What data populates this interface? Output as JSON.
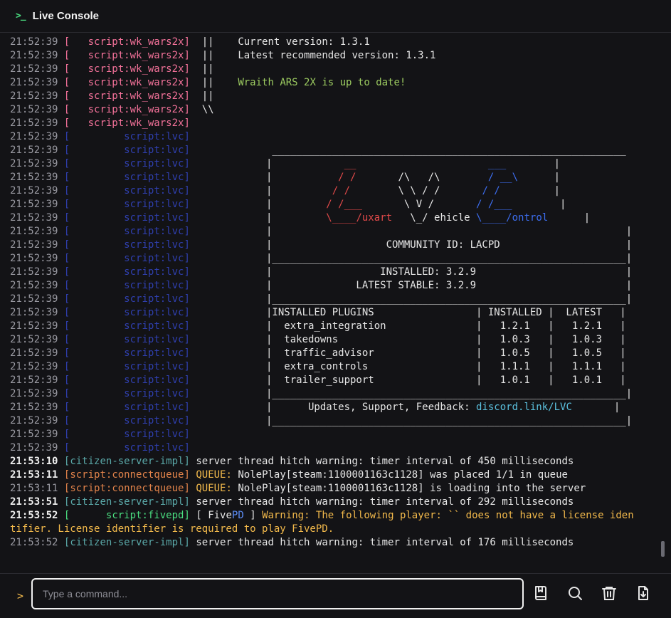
{
  "header": {
    "title": "Live Console",
    "icon": "terminal-icon",
    "icon_glyph": ">_"
  },
  "colors": {
    "wk": "#f4729a",
    "lvc": "#2f3fae",
    "citizen": "#5aa8a8",
    "cq": "#e0824a",
    "fivepd": "#4ade80",
    "yellow": "#f2b94b",
    "green_msg": "#9ccb60",
    "art_red": "#e24a4a",
    "art_blue": "#3d6ef0",
    "link": "#5bc0de",
    "fivepd_pd": "#5b8bf2"
  },
  "log": [
    {
      "ts": "21:52:39",
      "tag": "script:wk_wars2x",
      "type": "wk",
      "msg": "  ||    Current version: 1.3.1"
    },
    {
      "ts": "21:52:39",
      "tag": "script:wk_wars2x",
      "type": "wk",
      "msg": "  ||    Latest recommended version: 1.3.1"
    },
    {
      "ts": "21:52:39",
      "tag": "script:wk_wars2x",
      "type": "wk",
      "msg": "  ||"
    },
    {
      "ts": "21:52:39",
      "tag": "script:wk_wars2x",
      "type": "wk",
      "msg": "  ||    ",
      "green": "Wraith ARS 2X is up to date!"
    },
    {
      "ts": "21:52:39",
      "tag": "script:wk_wars2x",
      "type": "wk",
      "msg": "  ||"
    },
    {
      "ts": "21:52:39",
      "tag": "script:wk_wars2x",
      "type": "wk",
      "msg": "  \\\\"
    },
    {
      "ts": "21:52:39",
      "tag": "script:wk_wars2x",
      "type": "wk",
      "msg": ""
    },
    {
      "ts": "21:52:39",
      "tag": "script:lvc",
      "type": "lvc",
      "art": ""
    },
    {
      "ts": "21:52:39",
      "tag": "script:lvc",
      "type": "lvc",
      "art": " ___________________________________________________________"
    },
    {
      "ts": "21:52:39",
      "tag": "script:lvc",
      "type": "lvc",
      "art": "|",
      "r": "            __",
      "w": "                      ",
      "b": "___",
      "e": "        |"
    },
    {
      "ts": "21:52:39",
      "tag": "script:lvc",
      "type": "lvc",
      "art": "|",
      "r": "           / /",
      "w": "       /\\   /\\        ",
      "b": "/ __\\",
      "e": "      |"
    },
    {
      "ts": "21:52:39",
      "tag": "script:lvc",
      "type": "lvc",
      "art": "|",
      "r": "          / /",
      "w": "        \\ \\ / /       ",
      "b": "/ /",
      "e": "         |"
    },
    {
      "ts": "21:52:39",
      "tag": "script:lvc",
      "type": "lvc",
      "art": "|",
      "r": "         / /___",
      "w": "       \\ V /       ",
      "b": "/ /___",
      "e": "        |"
    },
    {
      "ts": "21:52:39",
      "tag": "script:lvc",
      "type": "lvc",
      "art": "|",
      "r": "         \\____/uxart",
      "w": "   \\_/ ehicle ",
      "b": "\\____/ontrol",
      "e": "      |"
    },
    {
      "ts": "21:52:39",
      "tag": "script:lvc",
      "type": "lvc",
      "art": "|                                                           |"
    },
    {
      "ts": "21:52:39",
      "tag": "script:lvc",
      "type": "lvc",
      "art": "|                   COMMUNITY ID: LACPD                     |"
    },
    {
      "ts": "21:52:39",
      "tag": "script:lvc",
      "type": "lvc",
      "art": "|___________________________________________________________|"
    },
    {
      "ts": "21:52:39",
      "tag": "script:lvc",
      "type": "lvc",
      "art": "|                  INSTALLED: 3.2.9                         |"
    },
    {
      "ts": "21:52:39",
      "tag": "script:lvc",
      "type": "lvc",
      "art": "|              LATEST STABLE: 3.2.9                         |"
    },
    {
      "ts": "21:52:39",
      "tag": "script:lvc",
      "type": "lvc",
      "art": "|___________________________________________________________|"
    },
    {
      "ts": "21:52:39",
      "tag": "script:lvc",
      "type": "lvc",
      "art": "|INSTALLED PLUGINS                 | INSTALLED |  LATEST   |"
    },
    {
      "ts": "21:52:39",
      "tag": "script:lvc",
      "type": "lvc",
      "art": "|  extra_integration               |   1.2.1   |   1.2.1   |"
    },
    {
      "ts": "21:52:39",
      "tag": "script:lvc",
      "type": "lvc",
      "art": "|  takedowns                       |   1.0.3   |   1.0.3   |"
    },
    {
      "ts": "21:52:39",
      "tag": "script:lvc",
      "type": "lvc",
      "art": "|  traffic_advisor                 |   1.0.5   |   1.0.5   |"
    },
    {
      "ts": "21:52:39",
      "tag": "script:lvc",
      "type": "lvc",
      "art": "|  extra_controls                  |   1.1.1   |   1.1.1   |"
    },
    {
      "ts": "21:52:39",
      "tag": "script:lvc",
      "type": "lvc",
      "art": "|  trailer_support                 |   1.0.1   |   1.0.1   |"
    },
    {
      "ts": "21:52:39",
      "tag": "script:lvc",
      "type": "lvc",
      "art": "|___________________________________________________________|"
    },
    {
      "ts": "21:52:39",
      "tag": "script:lvc",
      "type": "lvc",
      "art": "|      Updates, Support, Feedback: ",
      "link": "discord.link/LVC",
      "e": "       |"
    },
    {
      "ts": "21:52:39",
      "tag": "script:lvc",
      "type": "lvc",
      "art": "|___________________________________________________________|"
    },
    {
      "ts": "21:52:39",
      "tag": "script:lvc",
      "type": "lvc",
      "art": ""
    },
    {
      "ts": "21:52:39",
      "tag": "script:lvc",
      "type": "lvc",
      "art": ""
    },
    {
      "ts": "21:53:10",
      "hi": true,
      "tag": "citizen-server-impl",
      "type": "citizen",
      "msg": " server thread hitch warning: timer interval of 450 milliseconds"
    },
    {
      "ts": "21:53:11",
      "hi": true,
      "tag": "script:connectqueue",
      "type": "cq",
      "yel": " QUEUE:",
      "msg": " NolePlay[steam:1100001163c1128] was placed 1/1 in queue"
    },
    {
      "ts": "21:53:11",
      "tag": "script:connectqueue",
      "type": "cq",
      "yel": " QUEUE:",
      "msg": " NolePlay[steam:1100001163c1128] is loading into the server"
    },
    {
      "ts": "21:53:51",
      "hi": true,
      "tag": "citizen-server-impl",
      "type": "citizen",
      "msg": " server thread hitch warning: timer interval of 292 milliseconds"
    },
    {
      "ts": "21:53:52",
      "hi": true,
      "tag": "script:fivepd",
      "type": "fivepd",
      "msg": " [ Five",
      "pd": "PD",
      "msg2": " ] ",
      "yel2": "Warning: The following player: `` does not have a license identifier. License identifier is required to play FivePD.",
      "wrap": true
    },
    {
      "ts": "21:53:52",
      "tag": "citizen-server-impl",
      "type": "citizen",
      "msg": " server thread hitch warning: timer interval of 176 milliseconds"
    }
  ],
  "input": {
    "placeholder": "Type a command...",
    "value": ""
  },
  "footer": {
    "prompt_glyph": ">",
    "actions": [
      {
        "name": "bookmark-button",
        "icon": "bookmark-icon",
        "label": "Saved commands"
      },
      {
        "name": "search-button",
        "icon": "search-icon",
        "label": "Search"
      },
      {
        "name": "clear-button",
        "icon": "trash-icon",
        "label": "Clear"
      },
      {
        "name": "download-button",
        "icon": "download-icon",
        "label": "Download"
      }
    ]
  }
}
